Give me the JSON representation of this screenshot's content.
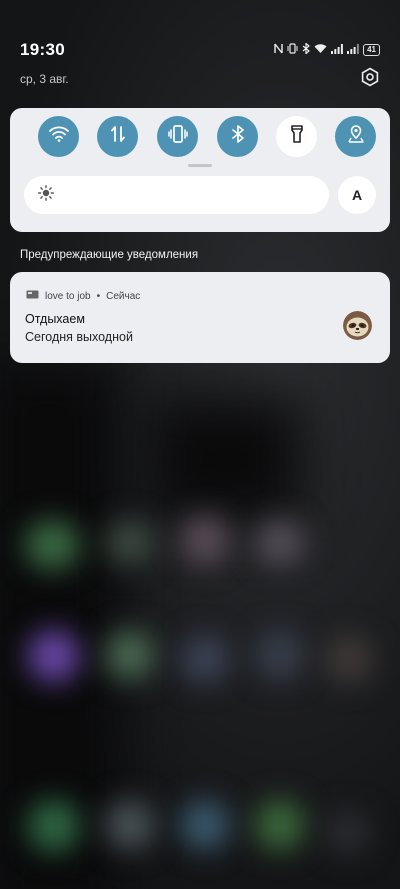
{
  "status_bar": {
    "time": "19:30",
    "battery": "41",
    "icons": [
      "nfc-icon",
      "vibrate-icon",
      "bluetooth-icon",
      "wifi-icon",
      "signal-icon",
      "signal-icon",
      "battery-icon"
    ]
  },
  "date": "ср, 3 авг.",
  "quick_settings": {
    "tiles": [
      {
        "icon": "wifi-icon",
        "active": true
      },
      {
        "icon": "mobile-data-icon",
        "active": true
      },
      {
        "icon": "vibrate-icon",
        "active": true
      },
      {
        "icon": "bluetooth-icon",
        "active": true
      },
      {
        "icon": "flashlight-icon",
        "active": false
      },
      {
        "icon": "location-icon",
        "active": true
      }
    ],
    "brightness_level": 0.0,
    "auto_label": "A",
    "accent_color": "#4e93b3"
  },
  "notifications": {
    "section_title": "Предупреждающие уведомления",
    "items": [
      {
        "app": "love to job",
        "time": "Сейчас",
        "title": "Отдыхаем",
        "body": "Сегодня выходной",
        "avatar_icon": "sloth-avatar"
      }
    ]
  }
}
